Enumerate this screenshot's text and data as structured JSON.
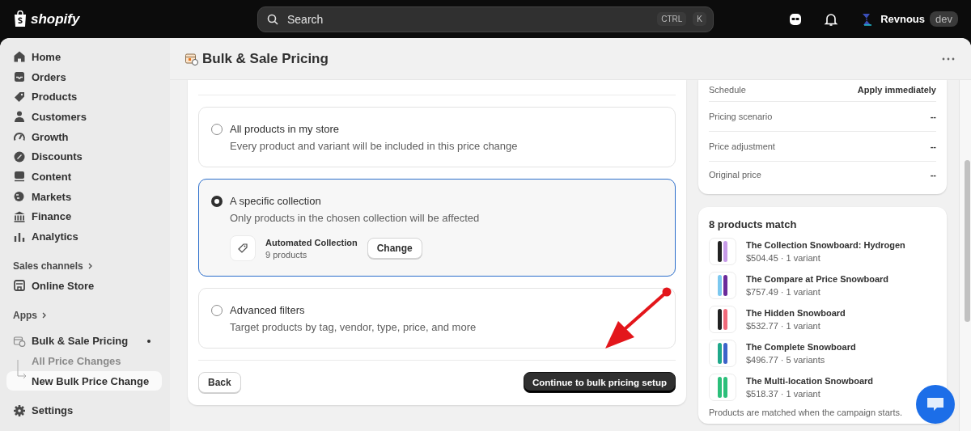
{
  "topbar": {
    "logo": "shopify",
    "search": {
      "placeholder": "Search"
    },
    "shortcut_keys": [
      "CTRL",
      "K"
    ],
    "store_name": "Revnous",
    "store_badge": "dev"
  },
  "sidebar": {
    "items": [
      {
        "label": "Home",
        "selected": false
      },
      {
        "label": "Orders",
        "selected": false
      },
      {
        "label": "Products",
        "selected": false
      },
      {
        "label": "Customers",
        "selected": false
      },
      {
        "label": "Growth",
        "selected": false
      },
      {
        "label": "Discounts",
        "selected": false
      },
      {
        "label": "Content",
        "selected": false
      },
      {
        "label": "Markets",
        "selected": false
      },
      {
        "label": "Finance",
        "selected": false
      },
      {
        "label": "Analytics",
        "selected": false
      }
    ],
    "sales_channels": {
      "heading": "Sales channels",
      "items": [
        {
          "label": "Online Store",
          "selected": false
        }
      ]
    },
    "apps": {
      "heading": "Apps",
      "app": {
        "label": "Bulk & Sale Pricing",
        "children": [
          {
            "label": "All Price Changes",
            "selected": false
          },
          {
            "label": "New Bulk Price Change",
            "selected": true
          }
        ]
      }
    },
    "settings": {
      "label": "Settings"
    }
  },
  "page": {
    "title": "Bulk & Sale Pricing"
  },
  "options": [
    {
      "title": "All products in my store",
      "description": "Every product and variant will be included in this price change",
      "selected": false
    },
    {
      "title": "A specific collection",
      "description": "Only products in the chosen collection will be affected",
      "selected": true,
      "collection": {
        "name": "Automated Collection",
        "count": "9 products",
        "button": "Change"
      }
    },
    {
      "title": "Advanced filters",
      "description": "Target products by tag, vendor, type, price, and more",
      "selected": false
    }
  ],
  "actions": {
    "back": "Back",
    "continue": "Continue to bulk pricing setup"
  },
  "summary": {
    "rows": [
      {
        "label": "Schedule",
        "value": "Apply immediately"
      },
      {
        "label": "Pricing scenario",
        "value": "--"
      },
      {
        "label": "Price adjustment",
        "value": "--"
      },
      {
        "label": "Original price",
        "value": "--"
      }
    ]
  },
  "matches": {
    "title": "8 products match",
    "products": [
      {
        "name": "The Collection Snowboard: Hydrogen",
        "meta": "$504.45 · 1 variant"
      },
      {
        "name": "The Compare at Price Snowboard",
        "meta": "$757.49 · 1 variant"
      },
      {
        "name": "The Hidden Snowboard",
        "meta": "$532.77 · 1 variant"
      },
      {
        "name": "The Complete Snowboard",
        "meta": "$496.77 · 5 variants"
      },
      {
        "name": "The Multi-location Snowboard",
        "meta": "$518.37 · 1 variant"
      }
    ],
    "note": "Products are matched when the campaign starts."
  }
}
